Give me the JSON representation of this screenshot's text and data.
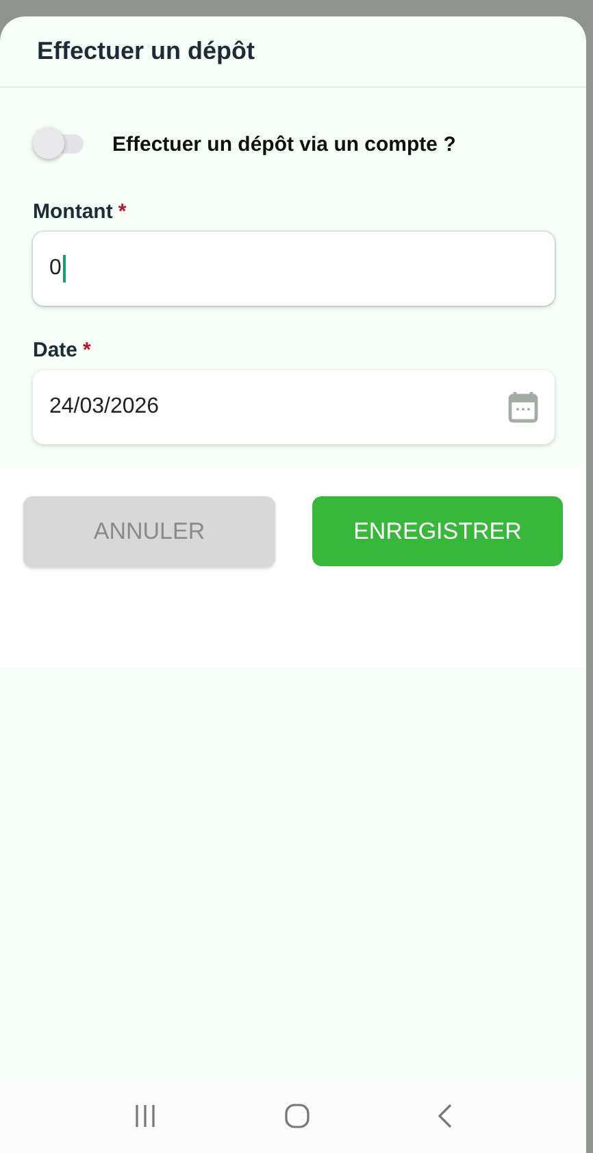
{
  "sheet": {
    "title": "Effectuer un dépôt"
  },
  "toggle": {
    "label": "Effectuer un dépôt via un compte ?",
    "on": false
  },
  "fields": [
    {
      "kind": "text",
      "label": "Montant",
      "required_mark": "*",
      "value": "0",
      "focused": true
    },
    {
      "kind": "date",
      "label": "Date",
      "required_mark": "*",
      "value": "24/03/2026",
      "focused": false
    }
  ],
  "buttons": [
    {
      "kind": "secondary",
      "label": "ANNULER"
    },
    {
      "kind": "primary",
      "label": "ENREGISTRER"
    }
  ]
}
